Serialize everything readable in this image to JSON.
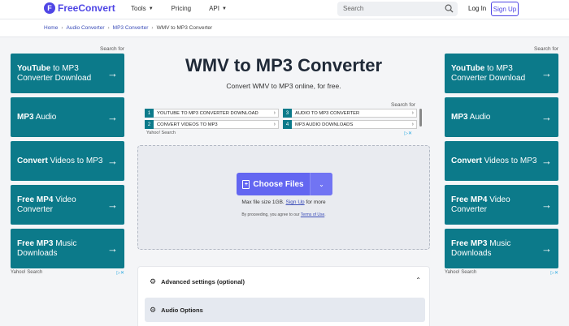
{
  "header": {
    "logo_letter": "F",
    "logo_free": "Free",
    "logo_convert": "Convert",
    "nav": [
      {
        "label": "Tools",
        "has_caret": true
      },
      {
        "label": "Pricing",
        "has_caret": false
      },
      {
        "label": "API",
        "has_caret": true
      }
    ],
    "search_placeholder": "Search",
    "login_label": "Log In",
    "signup_label": "Sign Up"
  },
  "breadcrumb": [
    "Home",
    "Audio Converter",
    "MP3 Converter",
    "WMV to MP3 Converter"
  ],
  "left_ads": {
    "search_for": "Search for",
    "tiles": [
      {
        "bold": "YouTube",
        "rest": " to MP3 Converter Download"
      },
      {
        "bold": "MP3",
        "rest": " Audio"
      },
      {
        "bold": "Convert",
        "rest": " Videos to MP3"
      },
      {
        "bold": "Free MP4 ",
        "rest": "Video Converter"
      },
      {
        "bold": "Free MP3 ",
        "rest": "Music Downloads"
      }
    ],
    "footer": "Yahoo! Search"
  },
  "right_ads": {
    "search_for": "Search for",
    "tiles": [
      {
        "bold": "YouTube",
        "rest": " to MP3 Converter Download"
      },
      {
        "bold": "MP3",
        "rest": " Audio"
      },
      {
        "bold": "Convert",
        "rest": " Videos to MP3"
      },
      {
        "bold": "Free MP4 ",
        "rest": "Video Converter"
      },
      {
        "bold": "Free MP3 ",
        "rest": "Music Downloads"
      }
    ],
    "footer": "Yahoo! Search"
  },
  "main": {
    "title": "WMV to MP3 Converter",
    "subtitle": "Convert WMV to MP3 online, for free.",
    "search_ad": {
      "search_for": "Search for",
      "keywords": [
        {
          "num": "1",
          "text": "YOUTUBE TO MP3 CONVERTER DOWNLOAD"
        },
        {
          "num": "2",
          "text": "CONVERT VIDEOS TO MP3"
        },
        {
          "num": "3",
          "text": "AUDIO TO MP3 CONVERTER"
        },
        {
          "num": "4",
          "text": "MP3 AUDIO DOWNLOADS"
        }
      ],
      "footer": "Yahoo! Search"
    },
    "upload": {
      "choose_label": "Choose Files",
      "max_size_prefix": "Max file size 1GB.",
      "signup_link": "Sign Up",
      "max_size_suffix": "for more",
      "terms_prefix": "By proceeding, you agree to our",
      "terms_link": "Terms of Use",
      "terms_suffix": "."
    },
    "advanced": {
      "heading": "Advanced settings (optional)",
      "audio_options": "Audio Options"
    }
  },
  "colors": {
    "accent": "#6366f1",
    "brand": "#4f46e5",
    "ad_tile": "#0c7a8a"
  }
}
